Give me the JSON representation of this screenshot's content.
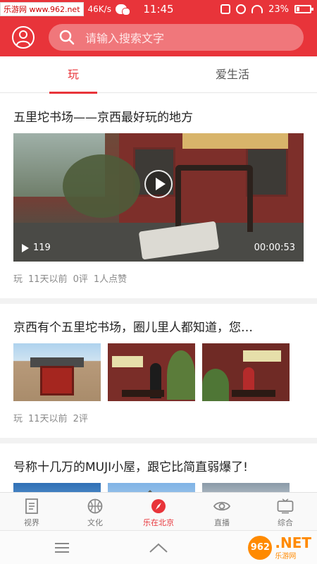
{
  "status_bar": {
    "watermark": "乐游网 www.962.net",
    "net_speed": "46K/s",
    "time": "11:45",
    "battery": "23%"
  },
  "header": {
    "search_placeholder": "请输入搜索文字"
  },
  "tabs": [
    {
      "label": "玩",
      "active": true
    },
    {
      "label": "爱生活",
      "active": false
    }
  ],
  "feed": [
    {
      "title": "五里坨书场——京西最好玩的地方",
      "type": "video",
      "views": "119",
      "duration": "00:00:53",
      "meta": [
        "玩",
        "11天以前",
        "0评",
        "1人点赞"
      ]
    },
    {
      "title": "京西有个五里坨书场，圈儿里人都知道，您…",
      "type": "gallery",
      "meta": [
        "玩",
        "11天以前",
        "2评"
      ]
    },
    {
      "title": "号称十几万的MUJI小屋，跟它比简直弱爆了!",
      "type": "gallery"
    }
  ],
  "bottom_nav": [
    {
      "label": "视界",
      "icon": "document-icon",
      "active": false
    },
    {
      "label": "文化",
      "icon": "basketball-icon",
      "active": false
    },
    {
      "label": "乐在北京",
      "icon": "compass-icon",
      "active": true
    },
    {
      "label": "直播",
      "icon": "eye-icon",
      "active": false
    },
    {
      "label": "综合",
      "icon": "tv-icon",
      "active": false
    }
  ],
  "watermark_bottom": {
    "logo_text": "962",
    "net_text": ".NET",
    "sub_text": "乐游网"
  },
  "colors": {
    "brand_red": "#e8343a",
    "meta_gray": "#8a8a8a"
  }
}
